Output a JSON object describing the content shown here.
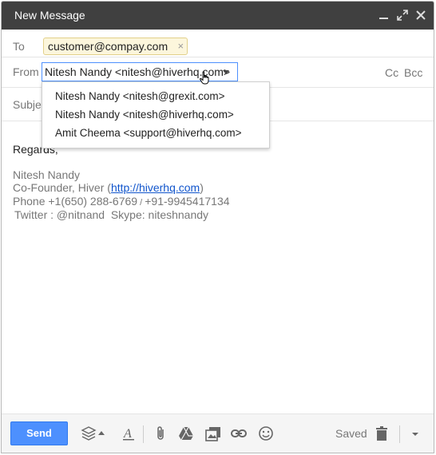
{
  "window": {
    "title": "New Message"
  },
  "to": {
    "label": "To",
    "recipient": "customer@compay.com",
    "remove_glyph": "×"
  },
  "from": {
    "label": "From",
    "selected": "Nitesh Nandy <nitesh@hiverhq.com>",
    "options": [
      "Nitesh Nandy <nitesh@grexit.com>",
      "Nitesh Nandy <nitesh@hiverhq.com>",
      "Amit Cheema <support@hiverhq.com>"
    ]
  },
  "cc_label": "Cc",
  "bcc_label": "Bcc",
  "subject": {
    "label_visible": "Subjec"
  },
  "body": {
    "greeting": "Regards,",
    "signature": {
      "name": "Nitesh Nandy",
      "title_prefix": "Co-Founder, Hiver (",
      "link": "http://hiverhq.com",
      "title_suffix": ")",
      "phone1": "Phone +1(650) 288-6769",
      "phone_sep": " / ",
      "phone2": "+91-9945417134",
      "twitter_label": "Twitter : ",
      "twitter_handle": "@nitnand",
      "skype_label": "  Skype: ",
      "skype_handle": "niteshnandy"
    }
  },
  "toolbar": {
    "send_label": "Send",
    "status": "Saved"
  },
  "colors": {
    "titlebar": "#404040",
    "send": "#4d90fe",
    "link": "#1155cc",
    "chip_bg": "#fcf6dc"
  }
}
